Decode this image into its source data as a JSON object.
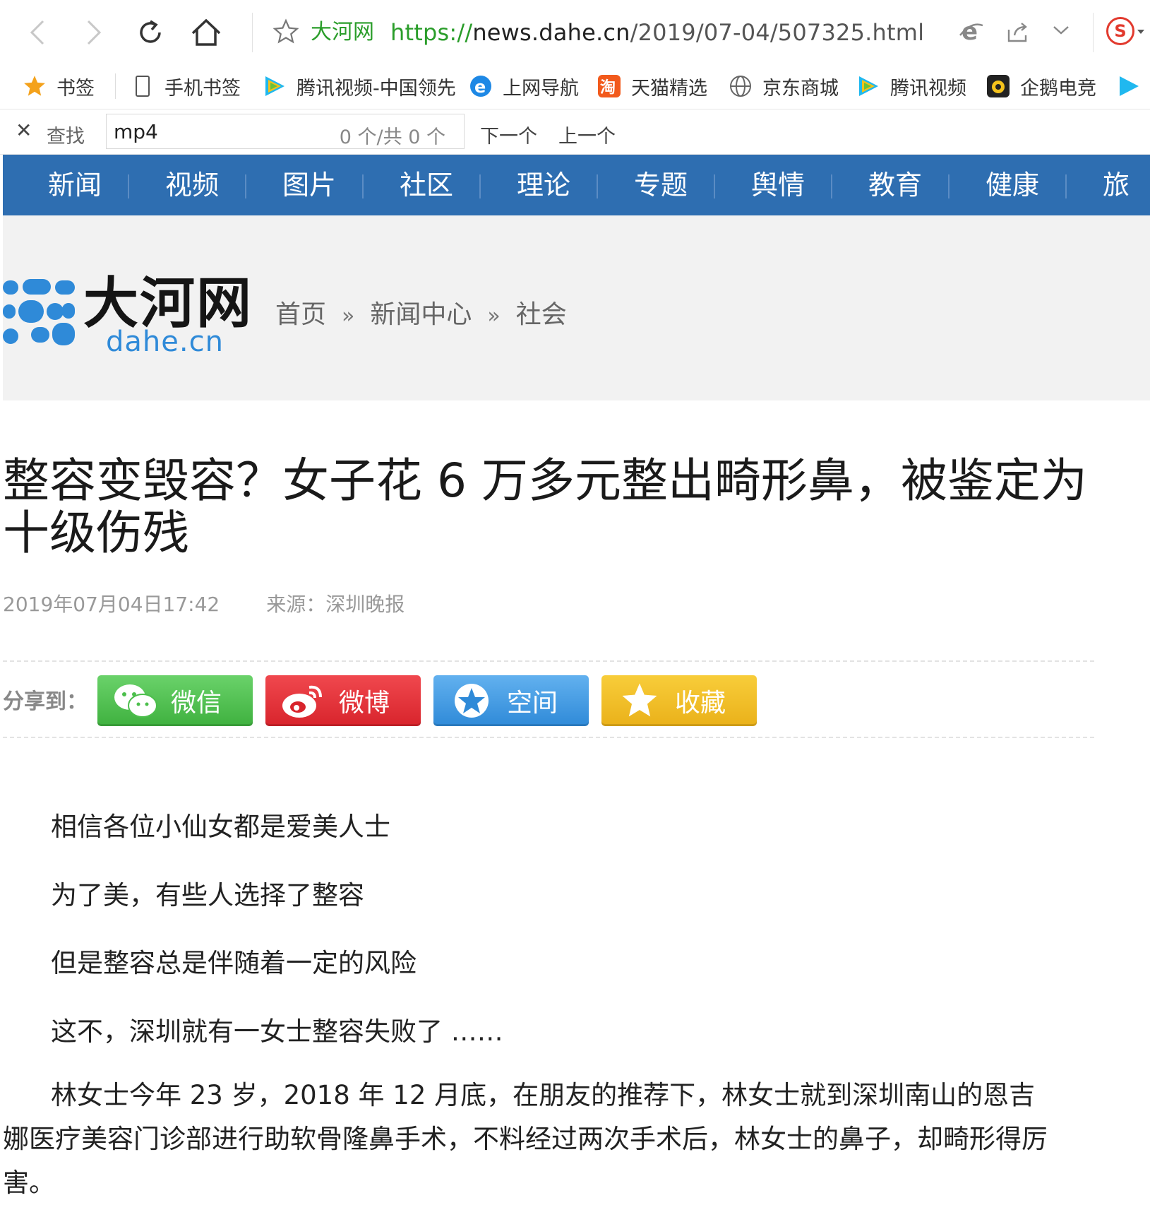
{
  "browser": {
    "site_name": "大河网",
    "url_scheme": "https://",
    "url_host": "news.dahe.cn",
    "url_path": "/2019/07-04/507325.html",
    "bookmarks": [
      {
        "label": "书签",
        "icon": "star-icon"
      },
      {
        "label": "手机书签",
        "icon": "phone-icon"
      },
      {
        "label": "腾讯视频-中国领先",
        "icon": "tencent-video-icon"
      },
      {
        "label": "上网导航",
        "icon": "ie-icon"
      },
      {
        "label": "天猫精选",
        "icon": "taobao-icon"
      },
      {
        "label": "京东商城",
        "icon": "globe-icon"
      },
      {
        "label": "腾讯视频",
        "icon": "tencent-video-icon"
      },
      {
        "label": "企鹅电竞",
        "icon": "penguin-esports-icon"
      }
    ],
    "find": {
      "label": "查找",
      "value": "mp4",
      "count": "0 个/共 0 个",
      "next": "下一个",
      "prev": "上一个"
    }
  },
  "site_nav": [
    "新闻",
    "视频",
    "图片",
    "社区",
    "理论",
    "专题",
    "舆情",
    "教育",
    "健康",
    "旅游"
  ],
  "logo": {
    "cn": "大河网",
    "en": "dahe.cn"
  },
  "breadcrumb": [
    "首页",
    "新闻中心",
    "社会"
  ],
  "breadcrumb_sep": "»",
  "article": {
    "title": "整容变毁容？女子花 6 万多元整出畸形鼻，被鉴定为十级伤残",
    "date": "2019年07月04日17:42",
    "source": "来源：深圳晚报",
    "share_label": "分享到：",
    "share_buttons": [
      "微信",
      "微博",
      "空间",
      "收藏"
    ],
    "paragraphs": [
      "相信各位小仙女都是爱美人士",
      "为了美，有些人选择了整容",
      "但是整容总是伴随着一定的风险",
      "这不，深圳就有一女士整容失败了 ……",
      "林女士今年 23 岁，2018 年 12 月底，在朋友的推荐下，林女士就到深圳南山的恩吉娜医疗美容门诊部进行助软骨隆鼻手术，不料经过两次手术后，林女士的鼻子，却畸形得厉害。"
    ]
  },
  "colors": {
    "nav_bg": "#2e6eb1",
    "header_bg": "#f2f2f2",
    "wechat": "#3fb13f",
    "weibo": "#d8242c",
    "qzone": "#2f8ad8",
    "favorite": "#eab11a"
  }
}
